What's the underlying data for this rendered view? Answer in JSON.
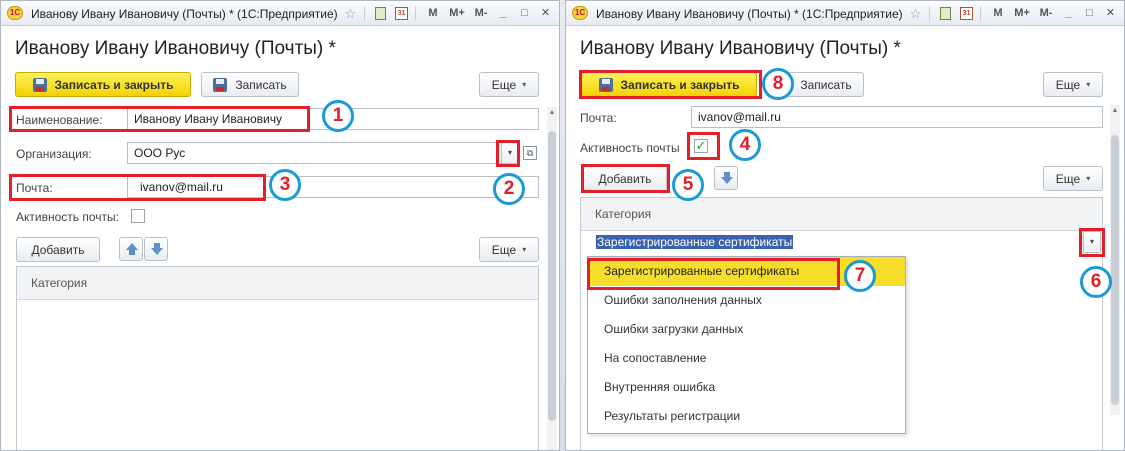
{
  "windows": {
    "left": {
      "title": "Иванову Ивану Ивановичу (Почты) * (1С:Предприятие)",
      "form_title": "Иванову Ивану Ивановичу (Почты) *",
      "save_close_label": "Записать и закрыть",
      "save_label": "Записать",
      "more_label": "Еще",
      "name_label": "Наименование:",
      "name_value": "Иванову Ивану Ивановичу",
      "org_label": "Организация:",
      "org_value": "ООО Рус",
      "email_label": "Почта:",
      "email_value": "ivanov@mail.ru",
      "active_label": "Активность почты:",
      "active_checked": false,
      "add_label": "Добавить",
      "table_more_label": "Еще",
      "table_header": "Категория"
    },
    "right": {
      "title": "Иванову Ивану Ивановичу (Почты) * (1С:Предприятие)",
      "form_title": "Иванову Ивану Ивановичу (Почты) *",
      "save_close_label": "Записать и закрыть",
      "save_label": "Записать",
      "more_label": "Еще",
      "email_label": "Почта:",
      "email_value": "ivanov@mail.ru",
      "active_label": "Активность почты",
      "active_checked": true,
      "check_mark": "✓",
      "add_label": "Добавить",
      "table_more_label": "Еще",
      "table_header": "Категория",
      "selected_category": "Зарегистрированные сертификаты",
      "dropdown_items": [
        "Зарегистрированные сертификаты",
        "Ошибки заполнения данных",
        "Ошибки загрузки данных",
        "На сопоставление",
        "Внутренняя ошибка",
        "Результаты регистрации"
      ]
    }
  },
  "toolbar": {
    "m_label": "M",
    "m_plus_label": "M+",
    "m_minus_label": "M-",
    "minimize": "_",
    "maximize": "□",
    "close": "✕",
    "star": "☆",
    "calendar": "31",
    "app_icon_text": "1C"
  },
  "glyphs": {
    "caret": "▾",
    "open": "⧉"
  },
  "annotations": [
    "1",
    "2",
    "3",
    "4",
    "5",
    "6",
    "7",
    "8"
  ],
  "colors": {
    "highlight": "#e3202a",
    "badge_border": "#1b9ad6",
    "primary_button": "#f2d200",
    "selection": "#3a62b0",
    "active_item": "#f6dd2a"
  }
}
